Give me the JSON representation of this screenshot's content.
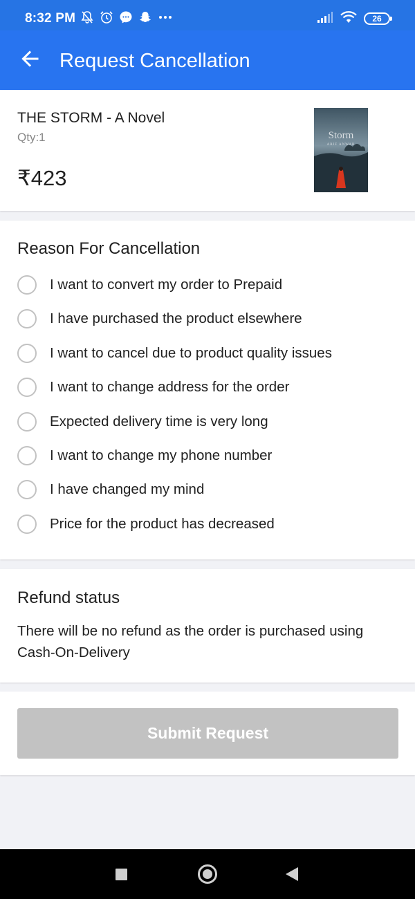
{
  "status_bar": {
    "time": "8:32 PM",
    "battery": "26",
    "left_icons": [
      "bell-off-icon",
      "alarm-icon",
      "messenger-icon",
      "snapchat-icon",
      "more-dots-icon"
    ],
    "right_icons": [
      "signal-icon",
      "wifi-icon",
      "battery-icon"
    ]
  },
  "app_bar": {
    "title": "Request Cancellation",
    "back_icon": "arrow-left-icon"
  },
  "product": {
    "name": "THE STORM - A Novel",
    "qty": "Qty:1",
    "price": "₹423",
    "cover_title": "Storm",
    "cover_author": "ARIF ANWAR"
  },
  "reasons": {
    "title": "Reason For Cancellation",
    "options": [
      "I want to convert my order to Prepaid",
      "I have purchased the product elsewhere",
      "I want to cancel due to product quality issues",
      "I want to change address for the order",
      "Expected delivery time is very long",
      "I want to change my phone number",
      "I have changed my mind",
      "Price for the product has decreased"
    ]
  },
  "refund": {
    "title": "Refund status",
    "text": "There will be no refund as the order is purchased using Cash-On-Delivery"
  },
  "submit": {
    "label": "Submit Request"
  },
  "colors": {
    "app_bar": "#2874f0",
    "status_bar": "#2674e4",
    "disabled_button": "#c2c2c2",
    "page_background": "#f1f2f6"
  }
}
